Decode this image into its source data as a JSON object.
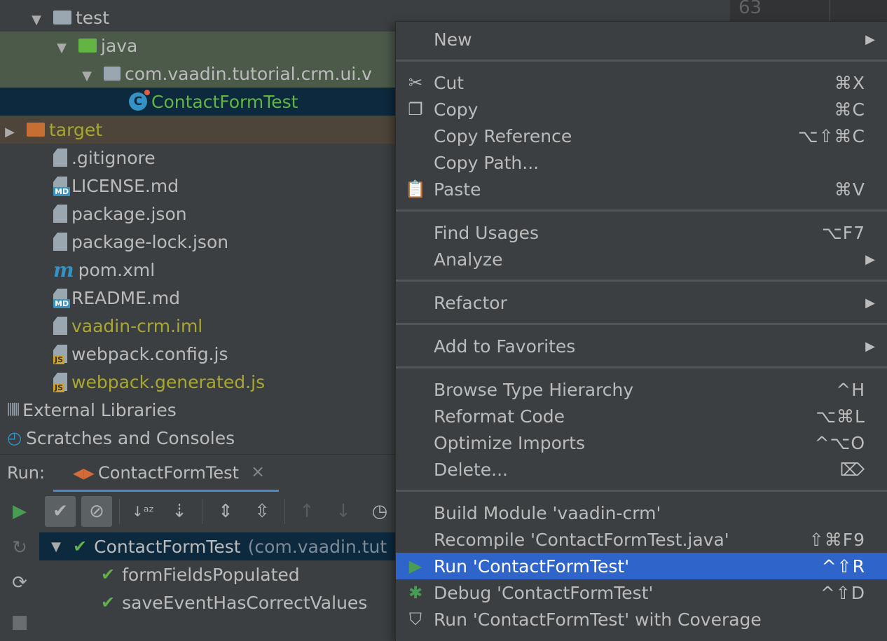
{
  "editor": {
    "line_number": "63"
  },
  "project_tree": [
    {
      "label": "test",
      "indent": 1,
      "arrow": "down",
      "icon": "folder-gray",
      "style": ""
    },
    {
      "label": "java",
      "indent": 2,
      "arrow": "down",
      "icon": "folder-green",
      "style": "hl-green"
    },
    {
      "label": "com.vaadin.tutorial.crm.ui.v",
      "indent": 3,
      "arrow": "down",
      "icon": "package",
      "style": "hl-green"
    },
    {
      "label": "ContactFormTest",
      "indent": 4,
      "arrow": "",
      "icon": "class",
      "style": "hl-sel",
      "color": "green"
    },
    {
      "label": "target",
      "indent": 0,
      "arrow": "right",
      "icon": "folder-orange",
      "style": "hl-orange",
      "color": "olive"
    },
    {
      "label": ".gitignore",
      "indent": 1,
      "arrow": "",
      "icon": "file-ignore",
      "style": ""
    },
    {
      "label": "LICENSE.md",
      "indent": 1,
      "arrow": "",
      "icon": "file-md",
      "style": ""
    },
    {
      "label": "package.json",
      "indent": 1,
      "arrow": "",
      "icon": "file-json",
      "style": ""
    },
    {
      "label": "package-lock.json",
      "indent": 1,
      "arrow": "",
      "icon": "file-json",
      "style": ""
    },
    {
      "label": "pom.xml",
      "indent": 1,
      "arrow": "",
      "icon": "maven",
      "style": ""
    },
    {
      "label": "README.md",
      "indent": 1,
      "arrow": "",
      "icon": "file-md",
      "style": ""
    },
    {
      "label": "vaadin-crm.iml",
      "indent": 1,
      "arrow": "",
      "icon": "file-iml",
      "style": "",
      "color": "olive"
    },
    {
      "label": "webpack.config.js",
      "indent": 1,
      "arrow": "",
      "icon": "file-js",
      "style": ""
    },
    {
      "label": "webpack.generated.js",
      "indent": 1,
      "arrow": "",
      "icon": "file-js",
      "style": "",
      "color": "olive"
    },
    {
      "label": "External Libraries",
      "indent": -1,
      "arrow": "right",
      "icon": "libraries",
      "style": ""
    },
    {
      "label": "Scratches and Consoles",
      "indent": -1,
      "arrow": "",
      "icon": "scratches",
      "style": ""
    }
  ],
  "run_panel": {
    "label": "Run:",
    "tab_label": "ContactFormTest",
    "close_glyph": "×",
    "tests": [
      {
        "name": "ContactFormTest",
        "detail": "(com.vaadin.tut",
        "level": 0
      },
      {
        "name": "formFieldsPopulated",
        "detail": "",
        "level": 1
      },
      {
        "name": "saveEventHasCorrectValues",
        "detail": "",
        "level": 1
      }
    ]
  },
  "context_menu": [
    {
      "type": "item",
      "label": "New",
      "shortcut": "",
      "submenu": true,
      "icon": ""
    },
    {
      "type": "sep"
    },
    {
      "type": "item",
      "label": "Cut",
      "shortcut": "⌘X",
      "icon": "scissors-icon"
    },
    {
      "type": "item",
      "label": "Copy",
      "shortcut": "⌘C",
      "icon": "copy-icon"
    },
    {
      "type": "item",
      "label": "Copy Reference",
      "shortcut": "⌥⇧⌘C",
      "icon": ""
    },
    {
      "type": "item",
      "label": "Copy Path...",
      "shortcut": "",
      "icon": ""
    },
    {
      "type": "item",
      "label": "Paste",
      "shortcut": "⌘V",
      "icon": "clipboard-icon"
    },
    {
      "type": "sep"
    },
    {
      "type": "item",
      "label": "Find Usages",
      "shortcut": "⌥F7",
      "icon": ""
    },
    {
      "type": "item",
      "label": "Analyze",
      "shortcut": "",
      "submenu": true,
      "icon": ""
    },
    {
      "type": "sep"
    },
    {
      "type": "item",
      "label": "Refactor",
      "shortcut": "",
      "submenu": true,
      "icon": ""
    },
    {
      "type": "sep"
    },
    {
      "type": "item",
      "label": "Add to Favorites",
      "shortcut": "",
      "submenu": true,
      "icon": ""
    },
    {
      "type": "sep"
    },
    {
      "type": "item",
      "label": "Browse Type Hierarchy",
      "shortcut": "^H",
      "icon": ""
    },
    {
      "type": "item",
      "label": "Reformat Code",
      "shortcut": "⌥⌘L",
      "icon": ""
    },
    {
      "type": "item",
      "label": "Optimize Imports",
      "shortcut": "^⌥O",
      "icon": ""
    },
    {
      "type": "item",
      "label": "Delete...",
      "shortcut": "⌦",
      "icon": ""
    },
    {
      "type": "sep"
    },
    {
      "type": "item",
      "label": "Build Module 'vaadin-crm'",
      "shortcut": "",
      "icon": ""
    },
    {
      "type": "item",
      "label": "Recompile 'ContactFormTest.java'",
      "shortcut": "⇧⌘F9",
      "icon": ""
    },
    {
      "type": "item",
      "label": "Run 'ContactFormTest'",
      "shortcut": "^⇧R",
      "icon": "run-icon",
      "active": true
    },
    {
      "type": "item",
      "label": "Debug 'ContactFormTest'",
      "shortcut": "^⇧D",
      "icon": "debug-icon"
    },
    {
      "type": "item",
      "label": "Run 'ContactFormTest' with Coverage",
      "shortcut": "",
      "icon": "coverage-icon"
    }
  ],
  "colors": {
    "accent": "#2f65ca",
    "success": "#5fb04a",
    "run": "#499c54"
  }
}
